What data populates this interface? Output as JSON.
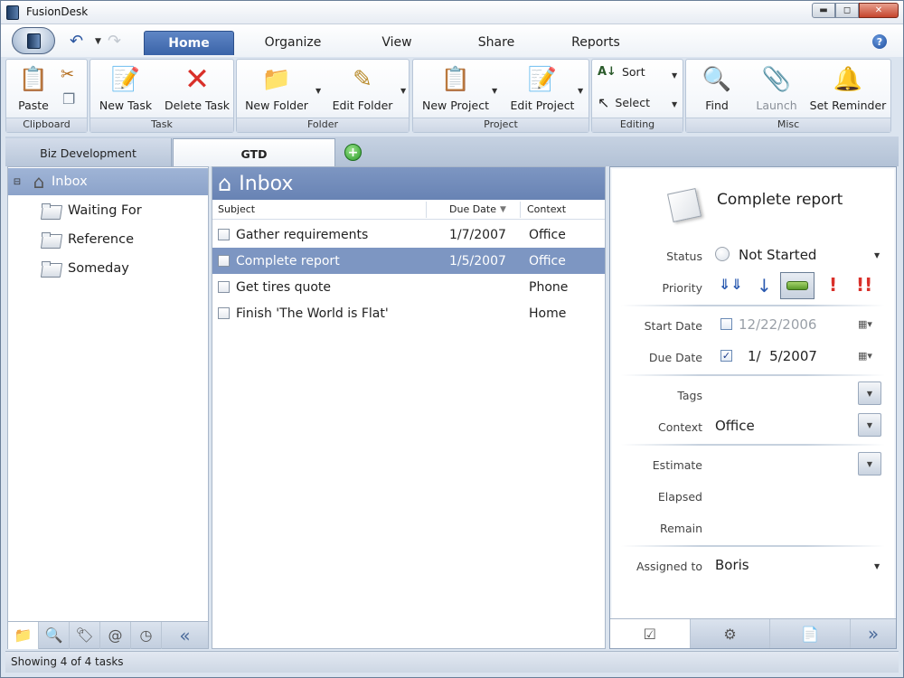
{
  "window": {
    "title": "FusionDesk"
  },
  "ribbon_tabs": [
    {
      "label": "Home",
      "active": true
    },
    {
      "label": "Organize"
    },
    {
      "label": "View"
    },
    {
      "label": "Share"
    },
    {
      "label": "Reports"
    }
  ],
  "groups": {
    "clipboard": {
      "name": "Clipboard",
      "paste": "Paste"
    },
    "task": {
      "name": "Task",
      "new_task": "New Task",
      "delete_task": "Delete Task"
    },
    "folder": {
      "name": "Folder",
      "new_folder": "New Folder",
      "edit_folder": "Edit Folder"
    },
    "project": {
      "name": "Project",
      "new_project": "New Project",
      "edit_project": "Edit Project"
    },
    "editing": {
      "name": "Editing",
      "sort": "Sort",
      "select": "Select"
    },
    "misc": {
      "name": "Misc",
      "find": "Find",
      "launch": "Launch",
      "set_reminder": "Set Reminder"
    }
  },
  "doc_tabs": [
    {
      "label": "Biz Development"
    },
    {
      "label": "GTD",
      "active": true
    }
  ],
  "tree": {
    "inbox": "Inbox",
    "items": [
      "Waiting For",
      "Reference",
      "Someday"
    ]
  },
  "list": {
    "title": "Inbox",
    "columns": {
      "subject": "Subject",
      "due_date": "Due Date",
      "context": "Context"
    },
    "rows": [
      {
        "subject": "Gather requirements",
        "due": "1/7/2007",
        "context": "Office"
      },
      {
        "subject": "Complete report",
        "due": "1/5/2007",
        "context": "Office",
        "selected": true
      },
      {
        "subject": "Get tires quote",
        "due": "",
        "context": "Phone"
      },
      {
        "subject": "Finish 'The World is Flat'",
        "due": "",
        "context": "Home"
      }
    ]
  },
  "details": {
    "title": "Complete report",
    "labels": {
      "status": "Status",
      "priority": "Priority",
      "start_date": "Start Date",
      "due_date": "Due Date",
      "tags": "Tags",
      "context": "Context",
      "estimate": "Estimate",
      "elapsed": "Elapsed",
      "remain": "Remain",
      "assigned_to": "Assigned to"
    },
    "status": "Not Started",
    "start_date": "12/22/2006",
    "due_date": "1/  5/2007",
    "tags": "",
    "context": "Office",
    "assigned_to": "Boris",
    "priority_marks": {
      "high": "!",
      "highest": "!!"
    }
  },
  "status_bar": {
    "text": "Showing 4 of 4 tasks"
  },
  "colors": {
    "accent": "#7d96c2",
    "selection": "#7d96c2",
    "delete": "#d9302a"
  }
}
